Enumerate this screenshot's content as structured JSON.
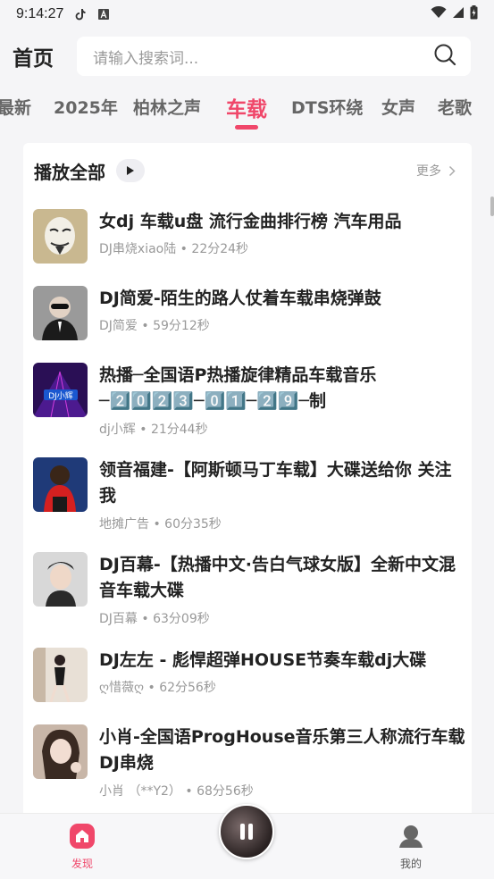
{
  "status": {
    "time": "9:14:27"
  },
  "header": {
    "title": "首页",
    "search_placeholder": "请输入搜索词..."
  },
  "tabs": [
    "最新",
    "2025年",
    "柏林之声",
    "车载",
    "DTS环绕",
    "女声",
    "老歌"
  ],
  "active_tab": "车载",
  "section": {
    "title": "播放全部",
    "more": "更多"
  },
  "songs": [
    {
      "title": "女dj 车载u盘 流行金曲排行榜  汽车用品",
      "artist": "DJ串烧xiao陆",
      "duration": "22分24秒"
    },
    {
      "title": "DJ简爱-陌生的路人仗着车载串烧弹鼓",
      "artist": "DJ简爱",
      "duration": "59分12秒"
    },
    {
      "title": "热播─全国语P热播旋律精品车载音乐─2️⃣0️⃣2️⃣3️⃣─0️⃣1️⃣─2️⃣9️⃣─制",
      "artist": "dj小辉",
      "duration": "21分44秒"
    },
    {
      "title": "领音福建-【阿斯顿马丁车载】大碟送给你 关注我",
      "artist": "地摊广告",
      "duration": "60分35秒"
    },
    {
      "title": "DJ百幕-【热播中文·告白气球女版】全新中文混音车载大碟",
      "artist": "DJ百幕",
      "duration": "63分09秒"
    },
    {
      "title": "DJ左左 - 彪悍超弹HOUSE节奏车载dj大碟",
      "artist": "ღ惜薇ღ",
      "duration": "62分56秒"
    },
    {
      "title": "小肖-全国语ProgHouse音乐第三人称流行车载DJ串烧",
      "artist": "小肖 （**Y2）",
      "duration": "68分56秒"
    }
  ],
  "nav": {
    "discover": "发现",
    "mine": "我的"
  },
  "colors": {
    "accent": "#f0476a"
  }
}
